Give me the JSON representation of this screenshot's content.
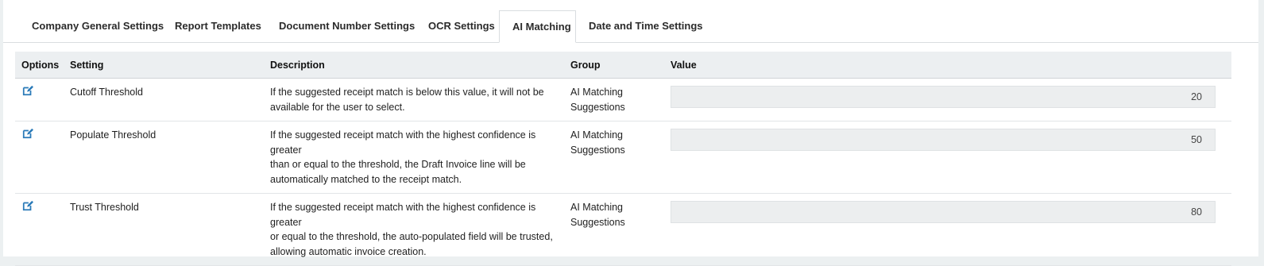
{
  "tabs": [
    {
      "label": "Company General Settings"
    },
    {
      "label": "Report Templates"
    },
    {
      "label": "Document Number Settings"
    },
    {
      "label": "OCR Settings"
    },
    {
      "label": "AI Matching",
      "active": true
    },
    {
      "label": "Date and Time Settings"
    }
  ],
  "table": {
    "headers": {
      "options": "Options",
      "setting": "Setting",
      "description": "Description",
      "group": "Group",
      "value": "Value"
    },
    "rows": [
      {
        "setting": "Cutoff Threshold",
        "description_lines": [
          "If the suggested receipt match is below this value, it will not be",
          "available for the user to select."
        ],
        "group_lines": [
          "AI Matching",
          "Suggestions"
        ],
        "value": "20"
      },
      {
        "setting": "Populate Threshold",
        "description_lines": [
          "If the suggested receipt match with the highest confidence is greater",
          "than or equal to the threshold, the Draft Invoice line will be",
          "automatically matched to the receipt match."
        ],
        "group_lines": [
          "AI Matching",
          "Suggestions"
        ],
        "value": "50"
      },
      {
        "setting": "Trust Threshold",
        "description_lines": [
          "If the suggested receipt match with the highest confidence is greater",
          "or equal to the threshold, the auto-populated field will be trusted,",
          "allowing automatic invoice creation."
        ],
        "group_lines": [
          "AI Matching",
          "Suggestions"
        ],
        "value": "80"
      }
    ]
  },
  "icons": {
    "row_option": "edit-icon"
  },
  "colors": {
    "accent": "#2a7ab8",
    "header_bg": "#eceff1",
    "value_bg": "#eceeef"
  }
}
